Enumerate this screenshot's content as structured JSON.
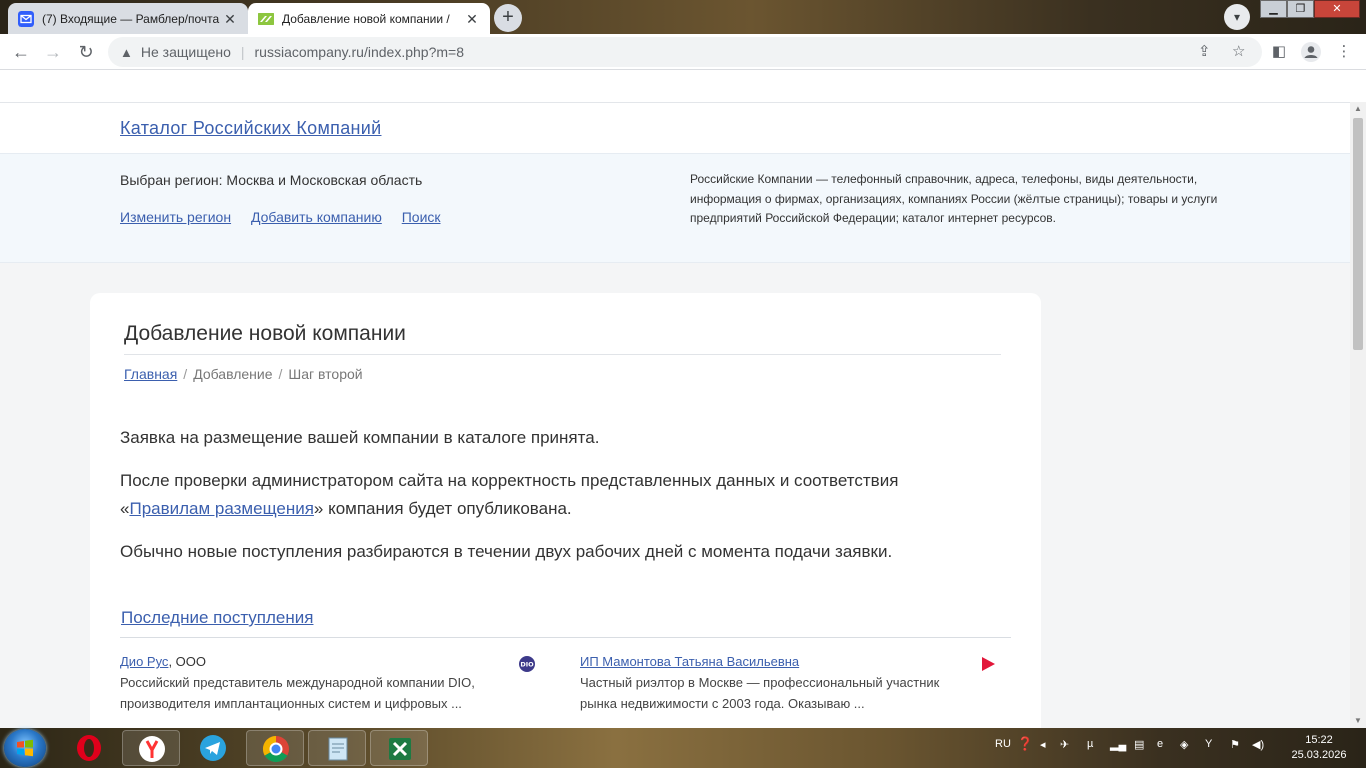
{
  "browser": {
    "tabs": [
      {
        "title": "(7) Входящие — Рамблер/почта",
        "active": false,
        "icon": "mail-icon"
      },
      {
        "title": "Добавление новой компании /",
        "active": true,
        "icon": "site-favicon"
      }
    ],
    "address": {
      "security_label": "Не защищено",
      "url": "russiacompany.ru/index.php?m=8"
    }
  },
  "site": {
    "title": "Каталог  Российских  Компаний",
    "region_text": "Выбран регион: Москва и Московская область",
    "links": {
      "change_region": "Изменить регион",
      "add_company": "Добавить компанию",
      "search": "Поиск"
    },
    "description": "Российские Компании — телефонный справочник, адреса, телефоны, виды деятельности, информация о фирмах, организациях, компаниях России (жёлтые страницы); товары и услуги предприятий Российской Федерации; каталог интернет ресурсов."
  },
  "main": {
    "heading": "Добавление новой компании",
    "breadcrumbs": {
      "home": "Главная",
      "add": "Добавление",
      "step": "Шаг второй"
    },
    "p1": "Заявка на размещение вашей компании в каталоге принята.",
    "p2_line1": "После проверки администратором сайта на корректность представленных данных и соответствия",
    "p2_quote_open": "«",
    "p2_link": "Правилам размещения",
    "p2_rest": "» компания будет опубликована.",
    "p3": "Обычно новые поступления разбираются в течении двух рабочих дней с момента подачи заявки.",
    "latest_heading": "Последние поступления",
    "latest": [
      {
        "name": "Дио Рус",
        "suffix": ", ООО",
        "desc_line1": "Российский представитель международной компании DIO,",
        "desc_line2": "производителя имплантационных систем и цифровых ..."
      },
      {
        "name": "ИП Мамонтова Татьяна Васильевна",
        "suffix": "",
        "desc_line1": "Частный риэлтор в Москве — профессиональный участник",
        "desc_line2": "рынка недвижимости с 2003 года. Оказываю ..."
      }
    ]
  },
  "taskbar": {
    "lang": "RU",
    "time": "15:22",
    "date": "25.03.2026"
  },
  "colors": {
    "link": "#3b5fae",
    "band": "#f3f8fc",
    "page_bg": "#f4f5f6"
  }
}
